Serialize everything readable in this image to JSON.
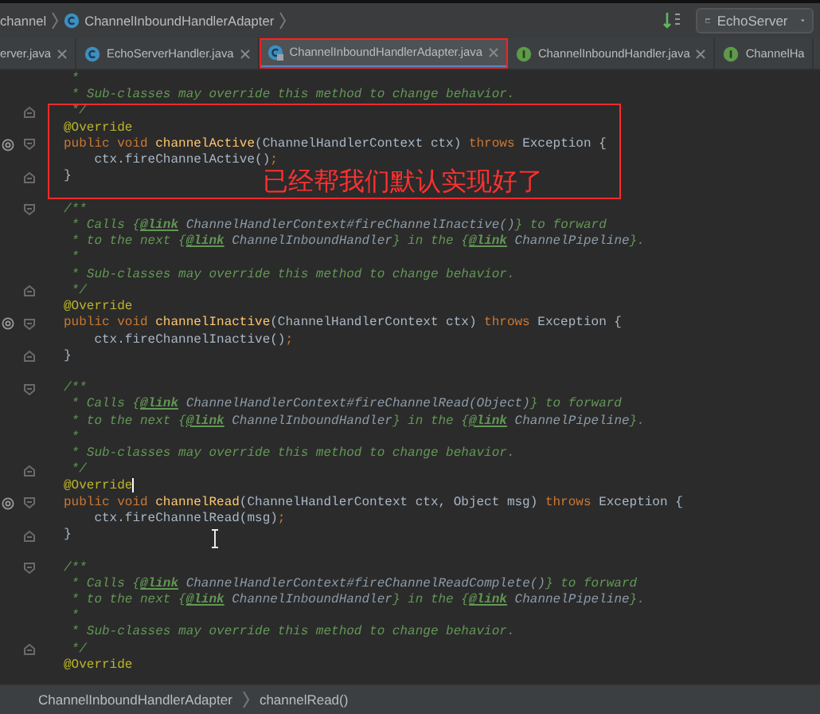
{
  "breadcrumb": {
    "items": [
      {
        "text": "channel",
        "kind": "package"
      },
      {
        "text": "ChannelInboundHandlerAdapter",
        "kind": "class"
      }
    ]
  },
  "run_config": {
    "label": "EchoServer"
  },
  "tabs": [
    {
      "label": "erver.java",
      "kind": "plain",
      "selected": false,
      "highlighted": false,
      "closable": true
    },
    {
      "label": "EchoServerHandler.java",
      "kind": "class",
      "selected": false,
      "highlighted": false,
      "closable": true
    },
    {
      "label": "ChannelInboundHandlerAdapter.java",
      "kind": "locked",
      "selected": true,
      "highlighted": true,
      "closable": true
    },
    {
      "label": "ChannelInboundHandler.java",
      "kind": "interface",
      "selected": false,
      "highlighted": false,
      "closable": true
    },
    {
      "label": "ChannelHa",
      "kind": "interface",
      "selected": false,
      "highlighted": false,
      "closable": false
    }
  ],
  "lines": [
    {
      "kind": "code",
      "override": false,
      "fold_start": false,
      "fold_end": false,
      "caret": false,
      "tokens": [
        {
          "kind": "doc",
          "text": " *"
        }
      ]
    },
    {
      "kind": "code",
      "override": false,
      "fold_start": false,
      "fold_end": false,
      "caret": false,
      "tokens": [
        {
          "kind": "doc",
          "text": " * Sub-classes may override this method to change behavior."
        }
      ]
    },
    {
      "kind": "code",
      "override": false,
      "fold_start": false,
      "fold_end": true,
      "caret": false,
      "tokens": [
        {
          "kind": "doc",
          "text": " */"
        }
      ]
    },
    {
      "kind": "code",
      "override": false,
      "fold_start": false,
      "fold_end": false,
      "caret": false,
      "tokens": [
        {
          "kind": "ann",
          "text": "@Override"
        }
      ]
    },
    {
      "kind": "code",
      "override": true,
      "fold_start": true,
      "fold_end": false,
      "caret": false,
      "tokens": [
        {
          "kind": "kw",
          "text": "public void "
        },
        {
          "kind": "method",
          "text": "channelActive"
        },
        {
          "kind": "plain",
          "text": "(ChannelHandlerContext ctx) "
        },
        {
          "kind": "kw",
          "text": "throws "
        },
        {
          "kind": "plain",
          "text": "Exception {"
        }
      ]
    },
    {
      "kind": "code",
      "override": false,
      "fold_start": false,
      "fold_end": false,
      "caret": false,
      "tokens": [
        {
          "kind": "plain",
          "text": "    ctx.fireChannelActive()"
        },
        {
          "kind": "kw",
          "text": ";"
        }
      ]
    },
    {
      "kind": "code",
      "override": false,
      "fold_start": false,
      "fold_end": true,
      "caret": false,
      "tokens": [
        {
          "kind": "plain",
          "text": "}"
        }
      ]
    },
    {
      "kind": "blank"
    },
    {
      "kind": "code",
      "override": false,
      "fold_start": true,
      "fold_end": false,
      "caret": false,
      "tokens": [
        {
          "kind": "doc",
          "text": "/**"
        }
      ]
    },
    {
      "kind": "code",
      "override": false,
      "fold_start": false,
      "fold_end": false,
      "caret": false,
      "tokens": [
        {
          "kind": "doc",
          "text": " * Calls {"
        },
        {
          "kind": "tag",
          "text": "@link"
        },
        {
          "kind": "ref",
          "text": " ChannelHandlerContext#fireChannelInactive()"
        },
        {
          "kind": "doc",
          "text": "} to forward"
        }
      ]
    },
    {
      "kind": "code",
      "override": false,
      "fold_start": false,
      "fold_end": false,
      "caret": false,
      "tokens": [
        {
          "kind": "doc",
          "text": " * to the next {"
        },
        {
          "kind": "tag",
          "text": "@link"
        },
        {
          "kind": "ref",
          "text": " ChannelInboundHandler"
        },
        {
          "kind": "doc",
          "text": "} in the {"
        },
        {
          "kind": "tag",
          "text": "@link"
        },
        {
          "kind": "ref",
          "text": " ChannelPipeline"
        },
        {
          "kind": "doc",
          "text": "}."
        }
      ]
    },
    {
      "kind": "code",
      "override": false,
      "fold_start": false,
      "fold_end": false,
      "caret": false,
      "tokens": [
        {
          "kind": "doc",
          "text": " *"
        }
      ]
    },
    {
      "kind": "code",
      "override": false,
      "fold_start": false,
      "fold_end": false,
      "caret": false,
      "tokens": [
        {
          "kind": "doc",
          "text": " * Sub-classes may override this method to change behavior."
        }
      ]
    },
    {
      "kind": "code",
      "override": false,
      "fold_start": false,
      "fold_end": true,
      "caret": false,
      "tokens": [
        {
          "kind": "doc",
          "text": " */"
        }
      ]
    },
    {
      "kind": "code",
      "override": false,
      "fold_start": false,
      "fold_end": false,
      "caret": false,
      "tokens": [
        {
          "kind": "ann",
          "text": "@Override"
        }
      ]
    },
    {
      "kind": "code",
      "override": true,
      "fold_start": true,
      "fold_end": false,
      "caret": false,
      "tokens": [
        {
          "kind": "kw",
          "text": "public void "
        },
        {
          "kind": "method",
          "text": "channelInactive"
        },
        {
          "kind": "plain",
          "text": "(ChannelHandlerContext ctx) "
        },
        {
          "kind": "kw",
          "text": "throws "
        },
        {
          "kind": "plain",
          "text": "Exception {"
        }
      ]
    },
    {
      "kind": "code",
      "override": false,
      "fold_start": false,
      "fold_end": false,
      "caret": false,
      "tokens": [
        {
          "kind": "plain",
          "text": "    ctx.fireChannelInactive()"
        },
        {
          "kind": "kw",
          "text": ";"
        }
      ]
    },
    {
      "kind": "code",
      "override": false,
      "fold_start": false,
      "fold_end": true,
      "caret": false,
      "tokens": [
        {
          "kind": "plain",
          "text": "}"
        }
      ]
    },
    {
      "kind": "blank"
    },
    {
      "kind": "code",
      "override": false,
      "fold_start": true,
      "fold_end": false,
      "caret": false,
      "tokens": [
        {
          "kind": "doc",
          "text": "/**"
        }
      ]
    },
    {
      "kind": "code",
      "override": false,
      "fold_start": false,
      "fold_end": false,
      "caret": false,
      "tokens": [
        {
          "kind": "doc",
          "text": " * Calls {"
        },
        {
          "kind": "tag",
          "text": "@link"
        },
        {
          "kind": "ref",
          "text": " ChannelHandlerContext#fireChannelRead(Object)"
        },
        {
          "kind": "doc",
          "text": "} to forward"
        }
      ]
    },
    {
      "kind": "code",
      "override": false,
      "fold_start": false,
      "fold_end": false,
      "caret": false,
      "tokens": [
        {
          "kind": "doc",
          "text": " * to the next {"
        },
        {
          "kind": "tag",
          "text": "@link"
        },
        {
          "kind": "ref",
          "text": " ChannelInboundHandler"
        },
        {
          "kind": "doc",
          "text": "} in the {"
        },
        {
          "kind": "tag",
          "text": "@link"
        },
        {
          "kind": "ref",
          "text": " ChannelPipeline"
        },
        {
          "kind": "doc",
          "text": "}."
        }
      ]
    },
    {
      "kind": "code",
      "override": false,
      "fold_start": false,
      "fold_end": false,
      "caret": false,
      "tokens": [
        {
          "kind": "doc",
          "text": " *"
        }
      ]
    },
    {
      "kind": "code",
      "override": false,
      "fold_start": false,
      "fold_end": false,
      "caret": false,
      "tokens": [
        {
          "kind": "doc",
          "text": " * Sub-classes may override this method to change behavior."
        }
      ]
    },
    {
      "kind": "code",
      "override": false,
      "fold_start": false,
      "fold_end": true,
      "caret": false,
      "tokens": [
        {
          "kind": "doc",
          "text": " */"
        }
      ]
    },
    {
      "kind": "code",
      "override": false,
      "fold_start": false,
      "fold_end": false,
      "caret": true,
      "tokens": [
        {
          "kind": "ann",
          "text": "@Override"
        }
      ]
    },
    {
      "kind": "code",
      "override": true,
      "fold_start": true,
      "fold_end": false,
      "caret": false,
      "tokens": [
        {
          "kind": "kw",
          "text": "public void "
        },
        {
          "kind": "method",
          "text": "channelRead"
        },
        {
          "kind": "plain",
          "text": "(ChannelHandlerContext ctx, Object msg) "
        },
        {
          "kind": "kw",
          "text": "throws "
        },
        {
          "kind": "plain",
          "text": "Exception {"
        }
      ]
    },
    {
      "kind": "code",
      "override": false,
      "fold_start": false,
      "fold_end": false,
      "caret": false,
      "tokens": [
        {
          "kind": "plain",
          "text": "    ctx.fireChannelRead(msg)"
        },
        {
          "kind": "kw",
          "text": ";"
        }
      ]
    },
    {
      "kind": "code",
      "override": false,
      "fold_start": false,
      "fold_end": true,
      "caret": false,
      "tokens": [
        {
          "kind": "plain",
          "text": "}"
        }
      ]
    },
    {
      "kind": "blank"
    },
    {
      "kind": "code",
      "override": false,
      "fold_start": true,
      "fold_end": false,
      "caret": false,
      "tokens": [
        {
          "kind": "doc",
          "text": "/**"
        }
      ]
    },
    {
      "kind": "code",
      "override": false,
      "fold_start": false,
      "fold_end": false,
      "caret": false,
      "tokens": [
        {
          "kind": "doc",
          "text": " * Calls {"
        },
        {
          "kind": "tag",
          "text": "@link"
        },
        {
          "kind": "ref",
          "text": " ChannelHandlerContext#fireChannelReadComplete()"
        },
        {
          "kind": "doc",
          "text": "} to forward"
        }
      ]
    },
    {
      "kind": "code",
      "override": false,
      "fold_start": false,
      "fold_end": false,
      "caret": false,
      "tokens": [
        {
          "kind": "doc",
          "text": " * to the next {"
        },
        {
          "kind": "tag",
          "text": "@link"
        },
        {
          "kind": "ref",
          "text": " ChannelInboundHandler"
        },
        {
          "kind": "doc",
          "text": "} in the {"
        },
        {
          "kind": "tag",
          "text": "@link"
        },
        {
          "kind": "ref",
          "text": " ChannelPipeline"
        },
        {
          "kind": "doc",
          "text": "}."
        }
      ]
    },
    {
      "kind": "code",
      "override": false,
      "fold_start": false,
      "fold_end": false,
      "caret": false,
      "tokens": [
        {
          "kind": "doc",
          "text": " *"
        }
      ]
    },
    {
      "kind": "code",
      "override": false,
      "fold_start": false,
      "fold_end": false,
      "caret": false,
      "tokens": [
        {
          "kind": "doc",
          "text": " * Sub-classes may override this method to change behavior."
        }
      ]
    },
    {
      "kind": "code",
      "override": false,
      "fold_start": false,
      "fold_end": true,
      "caret": false,
      "tokens": [
        {
          "kind": "doc",
          "text": " */"
        }
      ]
    },
    {
      "kind": "code",
      "override": false,
      "fold_start": false,
      "fold_end": false,
      "caret": false,
      "tokens": [
        {
          "kind": "ann",
          "text": "@Override"
        }
      ]
    }
  ],
  "annotation": {
    "text": "已经帮我们默认实现好了"
  },
  "status_bar": {
    "items": [
      "ChannelInboundHandlerAdapter",
      "channelRead()"
    ]
  }
}
